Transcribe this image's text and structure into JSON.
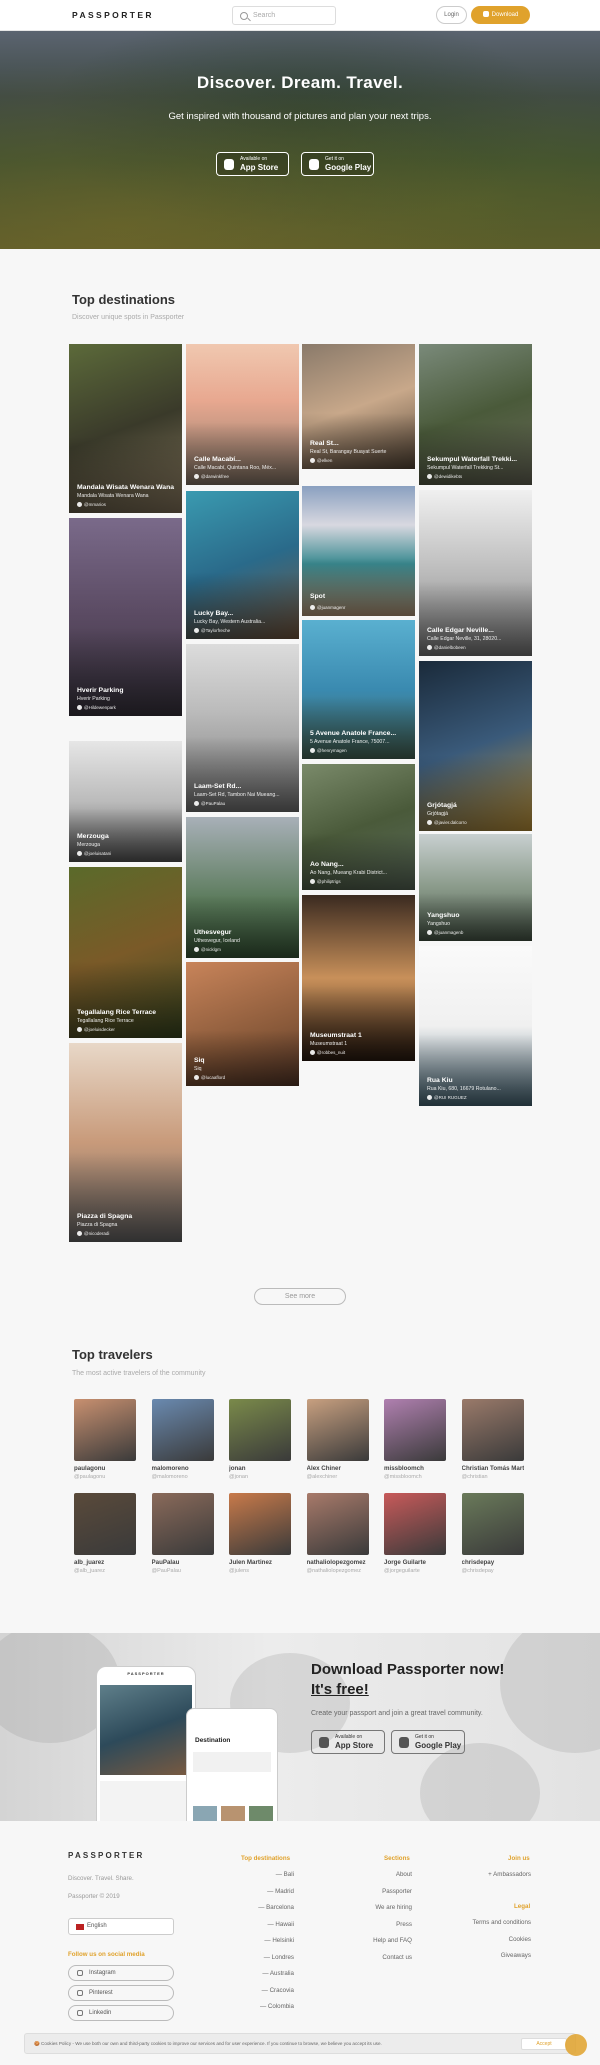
{
  "header": {
    "logo": "PASSPORTER",
    "search_placeholder": "Search",
    "login": "Login",
    "download": "Download"
  },
  "hero": {
    "title": "Discover. Dream. Travel.",
    "subtitle": "Get inspired with thousand of pictures and plan your next trips.",
    "appstore": {
      "small": "Available on",
      "big": "App Store"
    },
    "googleplay": {
      "small": "Get it on",
      "big": "Google Play"
    }
  },
  "destinations": {
    "title": "Top destinations",
    "subtitle": "Discover unique spots in Passporter",
    "tiles": [
      {
        "title": "Mandala Wisata Wenara Wana",
        "sub": "Mandala Wisata Wenara Wana",
        "user": "@mmarios"
      },
      {
        "title": "Hverir Parking",
        "sub": "Hverir Parking",
        "user": "@Hildewenpark"
      },
      {
        "title": "Merzouga",
        "sub": "Merzouga",
        "user": "@joeluisatani"
      },
      {
        "title": "Tegallalang Rice Terrace",
        "sub": "Tegallalang Rice Terrace",
        "user": "@joeluisdecker"
      },
      {
        "title": "Piazza di Spagna",
        "sub": "Piazza di Spagna",
        "user": "@nicoderadi"
      },
      {
        "title": "Calle Macabí...",
        "sub": "Calle Macabí, Quintana Roo, Méx...",
        "user": "@darwinkfree"
      },
      {
        "title": "Lucky Bay...",
        "sub": "Lucky Bay, Western Australia...",
        "user": "@Taylorfreche"
      },
      {
        "title": "Laam-Set Rd...",
        "sub": "Laam-Set Rd, Tambon Nai Mueang...",
        "user": "@PauPalau"
      },
      {
        "title": "Úthesvegur",
        "sub": "Úthesvegur, Iceland",
        "user": "@nicklgm"
      },
      {
        "title": "Siq",
        "sub": "Siq",
        "user": "@lucaaflord"
      },
      {
        "title": "Real St...",
        "sub": "Real St, Barangay Buayat Suerte",
        "user": "@elken"
      },
      {
        "title": "Spot",
        "sub": "",
        "user": "@juanmagenr"
      },
      {
        "title": "5 Avenue Anatole France...",
        "sub": "5 Avenue Anatole France, 75007...",
        "user": "@henrymagen"
      },
      {
        "title": "Ao Nang...",
        "sub": "Ao Nang, Mueang Krabi District...",
        "user": "@philiptrigs"
      },
      {
        "title": "Museumstraat 1",
        "sub": "Museumstraat 1",
        "user": "@robbes_nuit"
      },
      {
        "title": "Sekumpul Waterfall Trekki...",
        "sub": "Sekumpul Waterfall Trekking St...",
        "user": "@dewidikebts"
      },
      {
        "title": "Calle Edgar Neville...",
        "sub": "Calle Edgar Neville, 31, 28020...",
        "user": "@danielbobeen"
      },
      {
        "title": "Grjótagjá",
        "sub": "Grjótagjá",
        "user": "@javier.dalcorro"
      },
      {
        "title": "Yangshuo",
        "sub": "Yangshuo",
        "user": "@juanmagenb"
      },
      {
        "title": "Rua Kiu",
        "sub": "Rua Kiu, 680, 16679 Rotulano...",
        "user": "@RUI RUGUEZ"
      }
    ],
    "see_more": "See more"
  },
  "travelers": {
    "title": "Top travelers",
    "subtitle": "The most active travelers of the community",
    "list": [
      {
        "name": "paulagonu",
        "handle": "@paulagonu"
      },
      {
        "name": "malomoreno",
        "handle": "@malomoreno"
      },
      {
        "name": "jonan",
        "handle": "@jonan"
      },
      {
        "name": "Alex Chiner",
        "handle": "@alexchiner"
      },
      {
        "name": "missbloomch",
        "handle": "@missbloomch"
      },
      {
        "name": "Christian Tomás Mart...",
        "handle": "@christian"
      },
      {
        "name": "alb_juarez",
        "handle": "@alb_juarez"
      },
      {
        "name": "PauPalau",
        "handle": "@PauPalau"
      },
      {
        "name": "Julen Martinez",
        "handle": "@julens"
      },
      {
        "name": "nathaliolopezgomez",
        "handle": "@nathaliolopezgomez"
      },
      {
        "name": "Jorge Guilarte",
        "handle": "@jorgeguilarte"
      },
      {
        "name": "chrisdepay",
        "handle": "@chrisdepay"
      }
    ]
  },
  "promo": {
    "title": "Download Passporter now!",
    "title2": "It's free!",
    "desc": "Create your passport and join a great travel community.",
    "appstore": {
      "small": "Available on",
      "big": "App Store"
    },
    "googleplay": {
      "small": "Get it on",
      "big": "Google Play"
    },
    "phone": {
      "brand": "PASSPORTER",
      "card": "Destination"
    }
  },
  "footer": {
    "logo": "PASSPORTER",
    "tagline": "Discover. Travel. Share.",
    "copyright": "Passporter © 2019",
    "language": "English",
    "social_title": "Follow us on social media",
    "social": [
      "Instagram",
      "Pinterest",
      "Linkedin"
    ],
    "dest_title": "Top destinations",
    "destinations": [
      "— Bali",
      "— Madrid",
      "— Barcelona",
      "— Hawaii",
      "— Helsinki",
      "— Londres",
      "— Australia",
      "— Cracovia",
      "— Colombia"
    ],
    "sections_title": "Sections",
    "sections": [
      "About",
      "Passporter",
      "We are hiring",
      "Press",
      "Help and FAQ",
      "Contact us"
    ],
    "join_title": "Join us",
    "join": [
      "+ Ambassadors"
    ],
    "legal_title": "Legal",
    "legal": [
      "Terms and conditions",
      "Cookies",
      "Giveaways"
    ]
  },
  "cookie": {
    "text": "🍪 Cookies Policy - We use both our own and third-party cookies to improve our services and for user experience. If you continue to browse, we believe you accept its use.",
    "accept": "Accept"
  },
  "colors": {
    "accent": "#e0a22c"
  }
}
